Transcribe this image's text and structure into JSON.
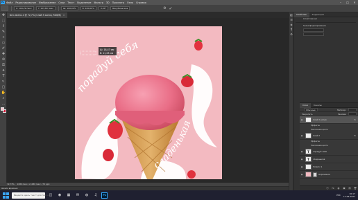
{
  "app": {
    "logo": "Ps"
  },
  "menu": [
    "Файл",
    "Редактирование",
    "Изображение",
    "Слои",
    "Текст",
    "Выделение",
    "Фильтр",
    "3D",
    "Просмотр",
    "Окно",
    "Справка"
  ],
  "window_controls": [
    "–",
    "□",
    "✕"
  ],
  "options": {
    "x_field": "X: 109,29 пикс",
    "y_field": "Y: 103,80 пикс",
    "w_field": "Ш: 100,00%",
    "h_field": "В: 100,00%",
    "angle_field": "0,00°",
    "interp": "Бикубическая",
    "cancel": "⊘",
    "commit": "✓"
  },
  "document_tab": {
    "title": "Без имени-1 @ 72,7% (Слой 3 копия, RGB/8)",
    "close": "×"
  },
  "tools": [
    "✥",
    "⬚",
    "ℓ",
    "✎",
    "⌖",
    "▭",
    "✐",
    "✚",
    "⊘",
    "⎚",
    "✦",
    "T",
    "↖",
    "▢",
    "✋",
    "⌕",
    "…"
  ],
  "status": {
    "zoom": "72,73%",
    "doc_info": "1080 пикс. x 1080 пикс. (72 ppi)"
  },
  "timeline": {
    "label": "Шкала времени"
  },
  "right_icons": [
    "◧",
    "☰",
    "◈",
    "¶",
    "⚙"
  ],
  "properties_panel": {
    "tabs": [
      "Свойства",
      "Коррекция"
    ],
    "lines": [
      "Слой пиксел",
      "Трансформирование"
    ]
  },
  "layers_panel": {
    "tabs": [
      "Слои",
      "Каналы"
    ],
    "blend_mode": "Обычные",
    "opacity_label": "Непрозр.",
    "lock_label": "Закрепить",
    "fill_label": "Заливка",
    "layers": [
      {
        "name": "Слой 3 копия",
        "selected": true,
        "fx": "fx"
      },
      {
        "name": "Эффекты",
        "sub": true
      },
      {
        "name": "Наложение цвета",
        "sub": true
      },
      {
        "name": "Слой 3",
        "fx": "fx"
      },
      {
        "name": "Эффекты",
        "sub": true
      },
      {
        "name": "Наложение цвета",
        "sub": true
      },
      {
        "name": "порадуй себя",
        "text": true
      },
      {
        "name": "сладенькая",
        "text": true
      },
      {
        "name": "Эллипс 1"
      },
      {
        "name": "мороженое"
      }
    ],
    "bottom_icons": [
      "ⓕ",
      "fx",
      "◐",
      "▣",
      "▤",
      "🗑"
    ]
  },
  "canvas": {
    "top_phrase": "порадуй себя",
    "bottom_phrase": "сладенькая",
    "readout_line1": "Ш: 18,47 мм",
    "readout_line2": "В: 11,23 мм",
    "colors": {
      "background": "#f3bac1",
      "scoop": "#e96d86",
      "cone": "#d9a25c",
      "stripe": "#ffffff"
    }
  },
  "taskbar": {
    "search_placeholder": "Введите здесь текст для поиска",
    "apps": [
      "◫",
      "◉",
      "▦",
      "✉",
      "◍",
      "♫",
      "Ps"
    ],
    "time": "10:17",
    "date": "17.05.2021",
    "lang": "РУС"
  }
}
